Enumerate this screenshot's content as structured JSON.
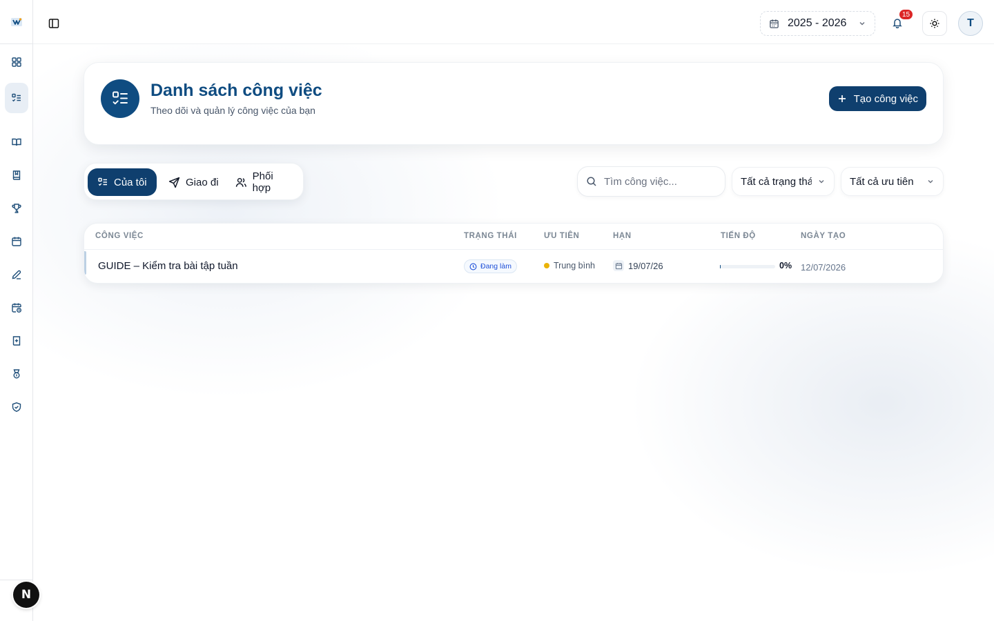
{
  "topbar": {
    "year": "2025 - 2026",
    "notifications_count": "15",
    "avatar_initial": "T"
  },
  "header": {
    "title": "Danh sách công việc",
    "subtitle": "Theo dõi và quản lý công việc của bạn",
    "create_button": "Tạo công việc"
  },
  "tabs": [
    {
      "label": "Của tôi",
      "icon": "list-checks-icon",
      "active": true
    },
    {
      "label": "Giao đi",
      "icon": "send-icon",
      "active": false
    },
    {
      "label": "Phối hợp",
      "icon": "users-icon",
      "active": false
    }
  ],
  "filters": {
    "search_placeholder": "Tìm công việc...",
    "status_value": "Tất cả trạng thái",
    "priority_value": "Tất cả ưu tiên"
  },
  "table": {
    "columns": [
      "CÔNG VIỆC",
      "TRẠNG THÁI",
      "ƯU TIÊN",
      "HẠN",
      "TIẾN ĐỘ",
      "NGÀY TẠO"
    ],
    "rows": [
      {
        "title": "GUIDE – Kiểm tra bài tập tuần",
        "status": "Đang làm",
        "priority": "Trung bình",
        "priority_color": "#eab308",
        "deadline": "19/07/26",
        "progress": "0%",
        "progress_value": 0,
        "created": "12/07/2026"
      }
    ]
  },
  "sidebar": {
    "items": [
      "grid-icon",
      "list-checks-icon",
      "book-open-icon",
      "book-icon",
      "trophy-icon",
      "calendar-icon",
      "pen-icon",
      "calendar-clock-icon",
      "book-plus-icon",
      "medal-icon",
      "shield-check-icon"
    ],
    "active_index": 1
  },
  "colors": {
    "primary": "#0f4c81",
    "primary_dark": "#0f3f6e",
    "badge_red": "#dc2626"
  },
  "dev_badge": "N"
}
